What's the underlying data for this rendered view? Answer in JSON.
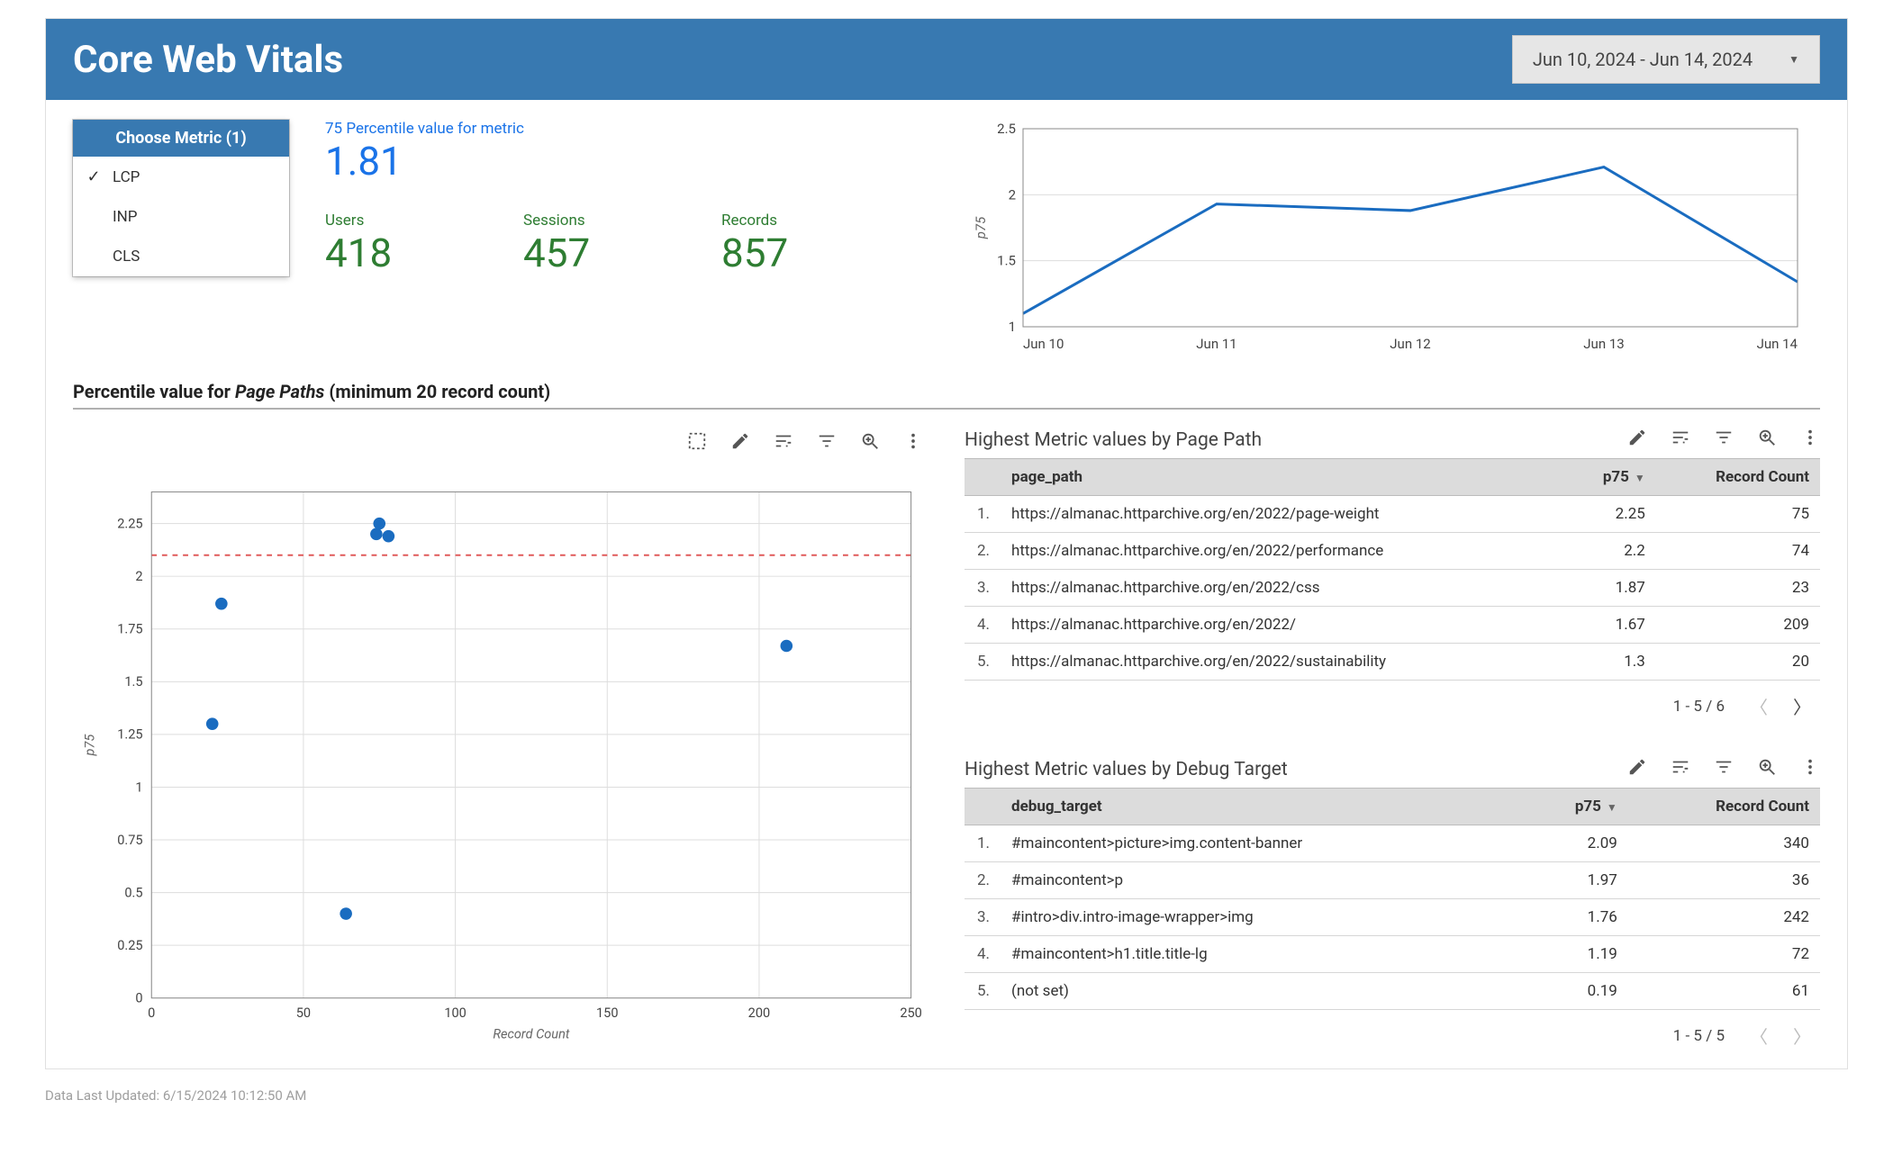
{
  "header": {
    "title": "Core Web Vitals",
    "date_range": "Jun 10, 2024 - Jun 14, 2024"
  },
  "metrics_panel": {
    "title": "Choose Metric (1)",
    "items": [
      {
        "label": "LCP",
        "selected": true
      },
      {
        "label": "INP",
        "selected": false
      },
      {
        "label": "CLS",
        "selected": false
      }
    ]
  },
  "headline_metric": {
    "label": "75 Percentile value for metric",
    "value": "1.81"
  },
  "counters": {
    "users": {
      "label": "Users",
      "value": "418"
    },
    "sessions": {
      "label": "Sessions",
      "value": "457"
    },
    "records": {
      "label": "Records",
      "value": "857"
    }
  },
  "section_title": {
    "prefix": "Percentile value for ",
    "italic": "Page Paths",
    "suffix": " (minimum 20 record count)"
  },
  "chart_data": [
    {
      "type": "line",
      "title": "",
      "xlabel": "",
      "ylabel": "p75",
      "categories": [
        "Jun 10",
        "Jun 11",
        "Jun 12",
        "Jun 13",
        "Jun 14"
      ],
      "values": [
        1.1,
        1.93,
        1.88,
        2.21,
        1.34
      ],
      "ylim": [
        1,
        2.5
      ],
      "yticks": [
        1,
        1.5,
        2,
        2.5
      ]
    },
    {
      "type": "scatter",
      "title": "Percentile value for Page Paths (minimum 20 record count)",
      "xlabel": "Record Count",
      "ylabel": "p75",
      "xlim": [
        0,
        250
      ],
      "ylim": [
        0,
        2.4
      ],
      "xticks": [
        0,
        50,
        100,
        150,
        200,
        250
      ],
      "yticks": [
        0,
        0.25,
        0.5,
        0.75,
        1,
        1.25,
        1.5,
        1.75,
        2,
        2.25
      ],
      "reference_line_y": 2.1,
      "points": [
        {
          "x": 75,
          "y": 2.25
        },
        {
          "x": 74,
          "y": 2.2
        },
        {
          "x": 23,
          "y": 1.87
        },
        {
          "x": 209,
          "y": 1.67
        },
        {
          "x": 20,
          "y": 1.3
        },
        {
          "x": 64,
          "y": 0.4
        },
        {
          "x": 78,
          "y": 2.19
        }
      ]
    }
  ],
  "table_page_path": {
    "title": "Highest Metric values by Page Path",
    "columns": {
      "c1": "page_path",
      "c2": "p75",
      "c3": "Record Count"
    },
    "rows": [
      {
        "n": "1.",
        "path": "https://almanac.httparchive.org/en/2022/page-weight",
        "p75": "2.25",
        "rc": "75"
      },
      {
        "n": "2.",
        "path": "https://almanac.httparchive.org/en/2022/performance",
        "p75": "2.2",
        "rc": "74"
      },
      {
        "n": "3.",
        "path": "https://almanac.httparchive.org/en/2022/css",
        "p75": "1.87",
        "rc": "23"
      },
      {
        "n": "4.",
        "path": "https://almanac.httparchive.org/en/2022/",
        "p75": "1.67",
        "rc": "209"
      },
      {
        "n": "5.",
        "path": "https://almanac.httparchive.org/en/2022/sustainability",
        "p75": "1.3",
        "rc": "20"
      }
    ],
    "pager": "1 - 5 / 6"
  },
  "table_debug_target": {
    "title": "Highest Metric values by Debug Target",
    "columns": {
      "c1": "debug_target",
      "c2": "p75",
      "c3": "Record Count"
    },
    "rows": [
      {
        "n": "1.",
        "path": "#maincontent>picture>img.content-banner",
        "p75": "2.09",
        "rc": "340"
      },
      {
        "n": "2.",
        "path": "#maincontent>p",
        "p75": "1.97",
        "rc": "36"
      },
      {
        "n": "3.",
        "path": "#intro>div.intro-image-wrapper>img",
        "p75": "1.76",
        "rc": "242"
      },
      {
        "n": "4.",
        "path": "#maincontent>h1.title.title-lg",
        "p75": "1.19",
        "rc": "72"
      },
      {
        "n": "5.",
        "path": "(not set)",
        "p75": "0.19",
        "rc": "61"
      }
    ],
    "pager": "1 - 5 / 5"
  },
  "footer": "Data Last Updated: 6/15/2024 10:12:50 AM",
  "icons": {
    "select_box": "select-box-icon",
    "pencil": "pencil-icon",
    "sliders": "sliders-icon",
    "filter": "filter-icon",
    "zoom": "zoom-icon",
    "more": "more-vert-icon"
  }
}
